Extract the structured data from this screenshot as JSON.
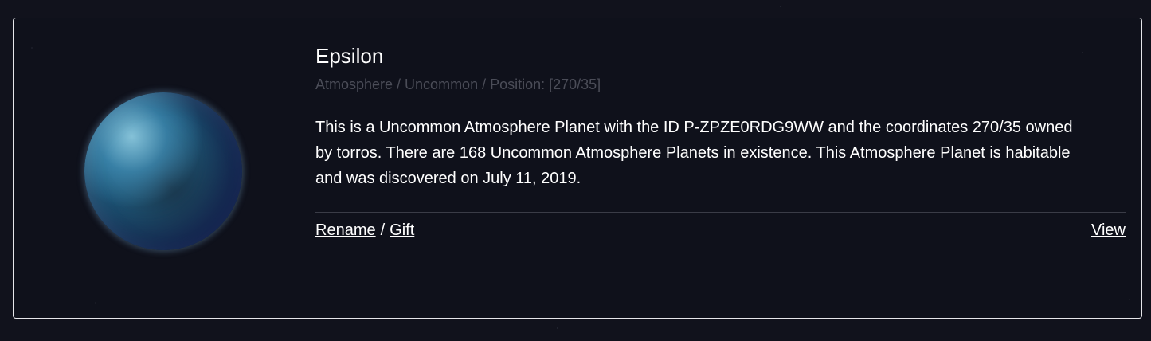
{
  "planet": {
    "name": "Epsilon",
    "meta": "Atmosphere / Uncommon / Position: [270/35]",
    "description": "This is a Uncommon Atmosphere Planet with the ID P-ZPZE0RDG9WW and the coordinates 270/35 owned by torros. There are 168 Uncommon Atmosphere Planets in existence. This Atmosphere Planet is habitable and was discovered on July 11, 2019.",
    "image_icon": "planet-image"
  },
  "actions": {
    "rename_label": "Rename",
    "separator": "/",
    "gift_label": "Gift",
    "view_label": "View"
  },
  "colors": {
    "background": "#11121c",
    "card_border": "#e6e6ea",
    "text": "#ffffff",
    "muted_text": "#4b4d58"
  }
}
